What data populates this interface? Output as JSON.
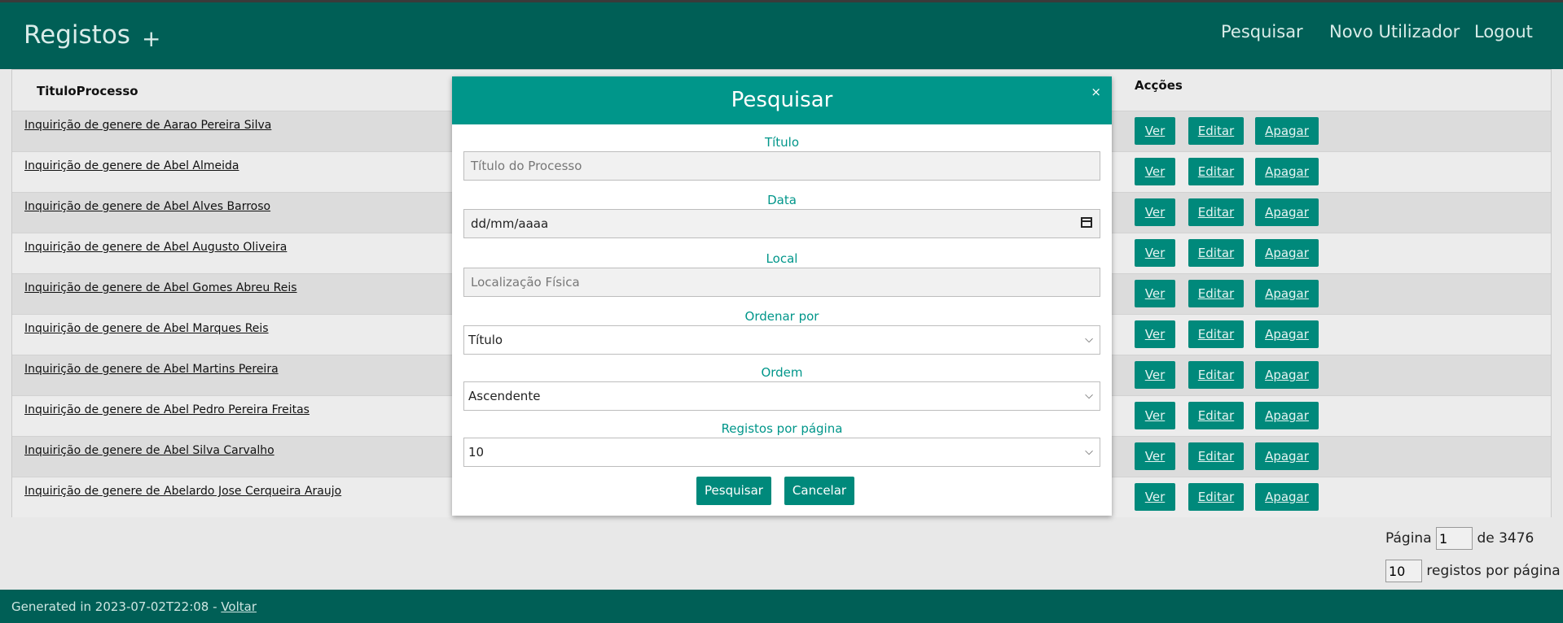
{
  "navbar": {
    "brand": "Registos",
    "add": "+",
    "links": [
      "Pesquisar",
      "Novo Utilizador",
      "Logout"
    ]
  },
  "table": {
    "headers": [
      "TituloProcesso",
      "Acções"
    ],
    "rows": [
      "Inquirição de genere de Aarao Pereira Silva",
      "Inquirição de genere de Abel Almeida",
      "Inquirição de genere de Abel Alves Barroso",
      "Inquirição de genere de Abel Augusto Oliveira",
      "Inquirição de genere de Abel Gomes Abreu Reis",
      "Inquirição de genere de Abel Marques Reis",
      "Inquirição de genere de Abel Martins Pereira",
      "Inquirição de genere de Abel Pedro Pereira Freitas",
      "Inquirição de genere de Abel Silva Carvalho",
      "Inquirição de genere de Abelardo Jose Cerqueira Araujo"
    ],
    "actions": [
      "Ver",
      "Editar",
      "Apagar"
    ]
  },
  "pagination": {
    "page_label": "Página",
    "page_value": "1",
    "of_label": "de 3476",
    "per_page_value": "10",
    "per_page_label": "registos por página"
  },
  "footer": {
    "text": "Generated in 2023-07-02T22:08 - ",
    "link": "Voltar"
  },
  "modal": {
    "title": "Pesquisar",
    "close": "×",
    "titulo_label": "Título",
    "titulo_placeholder": "Título do Processo",
    "data_label": "Data",
    "data_placeholder": "dd/mm/aaaa",
    "local_label": "Local",
    "local_placeholder": "Localização Física",
    "ordenar_label": "Ordenar por",
    "ordenar_value": "Título",
    "ordem_label": "Ordem",
    "ordem_value": "Ascendente",
    "registos_label": "Registos por página",
    "registos_value": "10",
    "submit": "Pesquisar",
    "cancel": "Cancelar"
  },
  "colors": {
    "navbar": "#005f56",
    "modal_header": "#00968a",
    "button": "#00897b"
  }
}
